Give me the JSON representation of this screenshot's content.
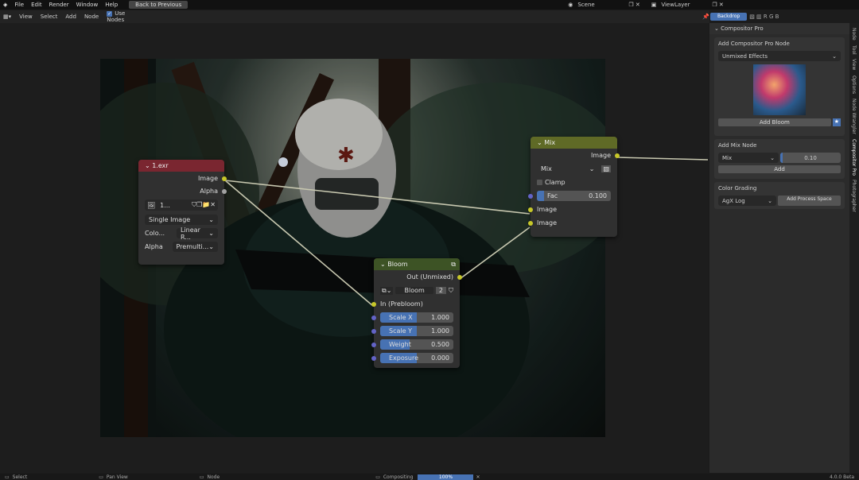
{
  "menu": {
    "file": "File",
    "edit": "Edit",
    "render": "Render",
    "window": "Window",
    "help": "Help",
    "back": "Back to Previous",
    "scene": "Scene",
    "view_layer": "ViewLayer"
  },
  "editor_header": {
    "view": "View",
    "select": "Select",
    "add": "Add",
    "node": "Node",
    "use_nodes": "Use Nodes",
    "backdrop": "Backdrop",
    "channels": [
      "R",
      "G",
      "B"
    ]
  },
  "nodes": {
    "exr": {
      "title": "1.exr",
      "out_image": "Image",
      "out_alpha": "Alpha",
      "file": "1...",
      "source": "Single Image",
      "color_label": "Colo...",
      "color_value": "Linear R...",
      "alpha_label": "Alpha",
      "alpha_value": "Premulti..."
    },
    "mix": {
      "title": "Mix",
      "out_image": "Image",
      "blend": "Mix",
      "clamp": "Clamp",
      "fac_label": "Fac",
      "fac_value": "0.100",
      "fac": 0.1,
      "in1": "Image",
      "in2": "Image"
    },
    "bloom": {
      "title": "Bloom",
      "out": "Out (Unmixed)",
      "preset": "Bloom",
      "users": "2",
      "in": "In (Prebloom)",
      "params": [
        {
          "label": "Scale X",
          "value": "1.000",
          "fill": 0.5
        },
        {
          "label": "Scale Y",
          "value": "1.000",
          "fill": 0.5
        },
        {
          "label": "Weight",
          "value": "0.500",
          "fill": 0.4
        },
        {
          "label": "Exposure",
          "value": "0.000",
          "fill": 0.5
        }
      ]
    }
  },
  "sidebar": {
    "title": "Compositor Pro",
    "add_section": "Add Compositor Pro Node",
    "effects_dropdown": "Unmixed Effects",
    "add_bloom": "Add Bloom",
    "mix_section": "Add Mix Node",
    "mix_type": "Mix",
    "mix_value": "0.10",
    "mix_fill": 0.04,
    "add": "Add",
    "grading": "Color Grading",
    "agx": "AgX Log",
    "process": "Add Process Space"
  },
  "tabs": [
    "Node",
    "Tool",
    "View",
    "Options",
    "Node Wrangler",
    "Compositor Pro",
    "Photographer"
  ],
  "status": {
    "select": "Select",
    "pan": "Pan View",
    "node": "Node",
    "compositing": "Compositing",
    "progress": "100%",
    "version": "4.0.0 Beta"
  }
}
